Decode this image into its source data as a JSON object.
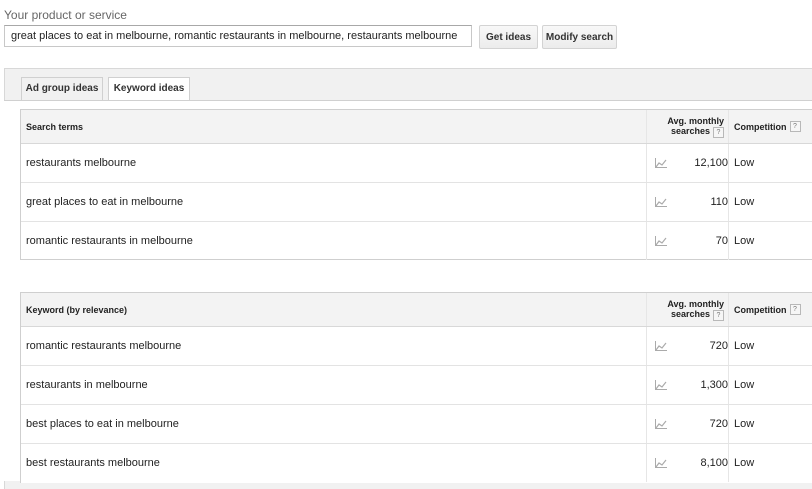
{
  "search": {
    "label": "Your product or service",
    "value": "great places to eat in melbourne, romantic restaurants in melbourne, restaurants melbourne",
    "get_ideas": "Get ideas",
    "modify_search": "Modify search"
  },
  "tabs": [
    "Ad group ideas",
    "Keyword ideas"
  ],
  "help_glyph": "?",
  "search_terms": {
    "headers": {
      "term": "Search terms",
      "avg_line1": "Avg. monthly",
      "avg_line2": "searches",
      "competition": "Competition"
    },
    "rows": [
      {
        "term": "restaurants melbourne",
        "avg": "12,100",
        "competition": "Low"
      },
      {
        "term": "great places to eat in melbourne",
        "avg": "110",
        "competition": "Low"
      },
      {
        "term": "romantic restaurants in melbourne",
        "avg": "70",
        "competition": "Low"
      }
    ]
  },
  "keywords": {
    "headers": {
      "term": "Keyword (by relevance)",
      "avg_line1": "Avg. monthly",
      "avg_line2": "searches",
      "competition": "Competition"
    },
    "rows": [
      {
        "term": "romantic restaurants melbourne",
        "avg": "720",
        "competition": "Low"
      },
      {
        "term": "restaurants in melbourne",
        "avg": "1,300",
        "competition": "Low"
      },
      {
        "term": "best places to eat in melbourne",
        "avg": "720",
        "competition": "Low"
      },
      {
        "term": "best restaurants melbourne",
        "avg": "8,100",
        "competition": "Low"
      }
    ]
  },
  "icons": {
    "trend": "trend-chart-icon",
    "help": "help-icon"
  }
}
